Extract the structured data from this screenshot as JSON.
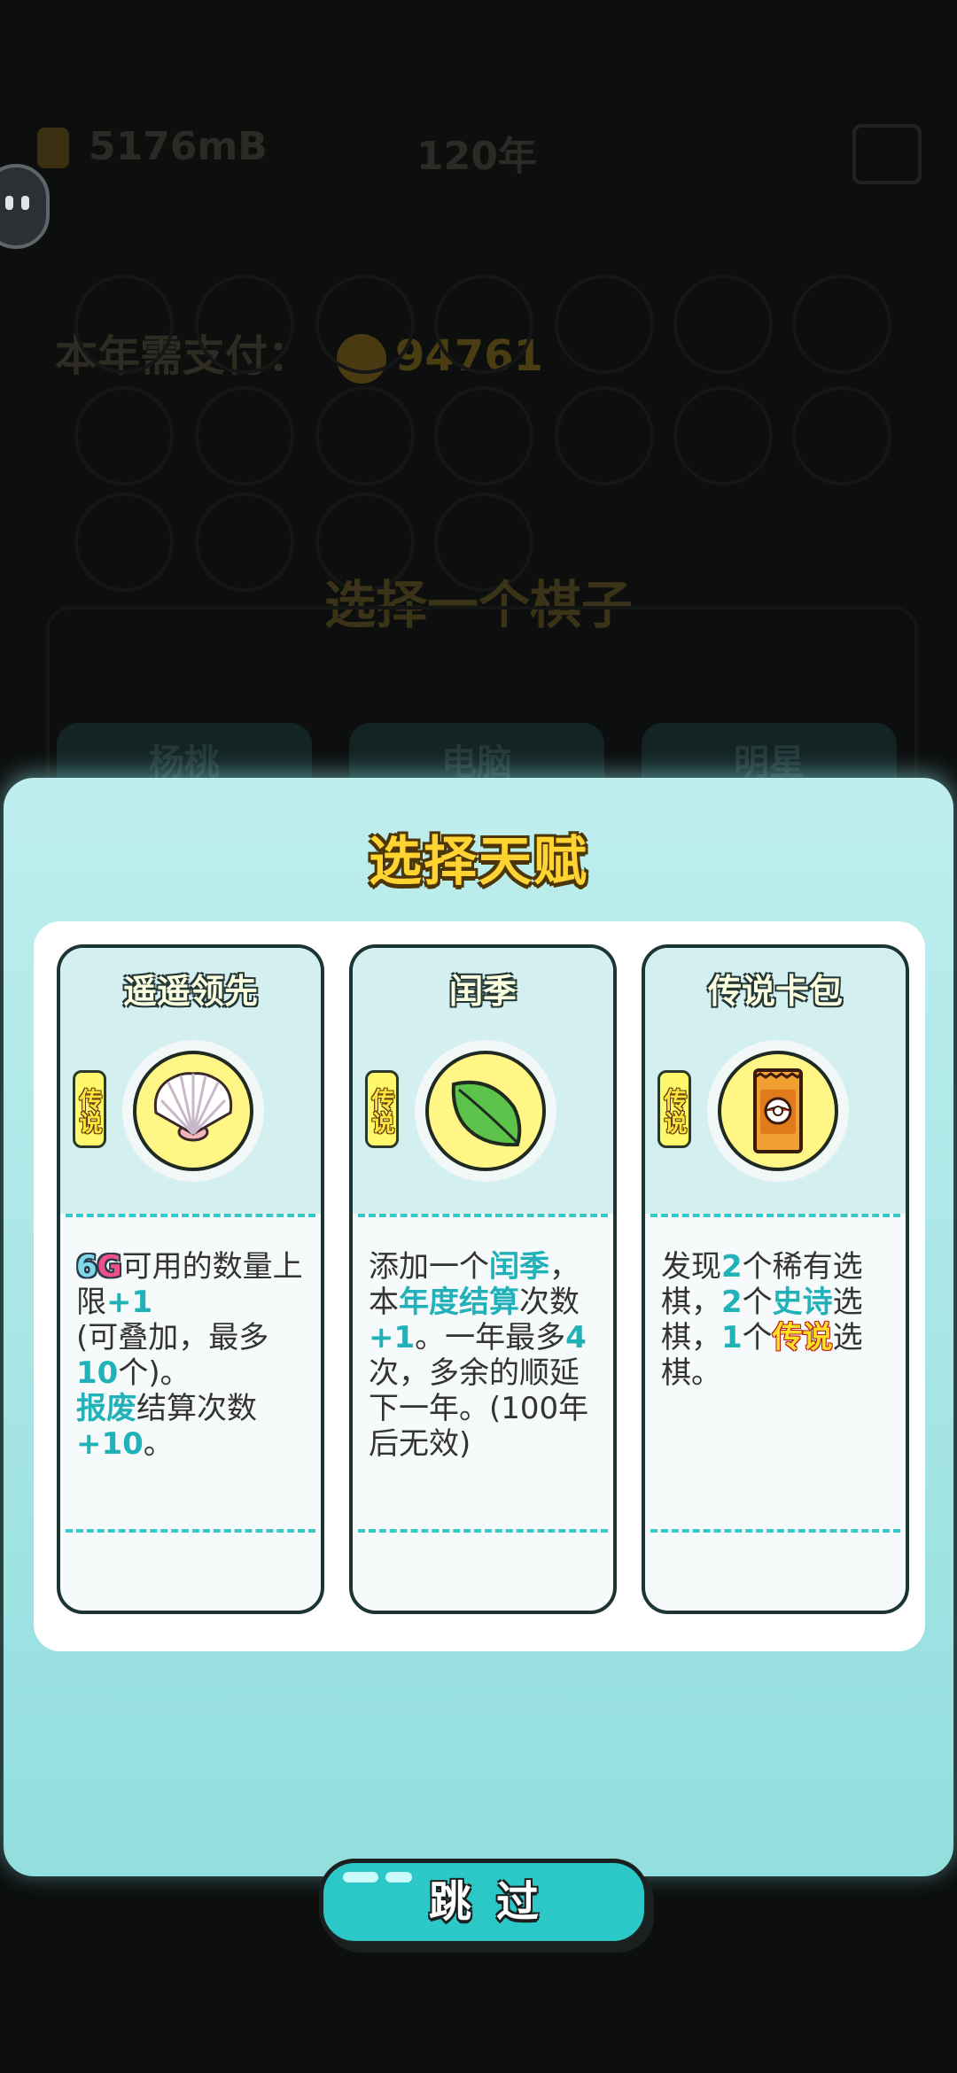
{
  "background": {
    "money": "5176mB",
    "year": "120年",
    "pay_label": "本年需支付：",
    "pay_amount": "94761",
    "select_piece_title": "选择一个棋子",
    "tabs": [
      "杨桃",
      "电脑",
      "明星"
    ]
  },
  "dialog": {
    "title": "选择天赋",
    "cards": [
      {
        "name": "遥遥领先",
        "rarity": "传说",
        "icon": "shell-icon",
        "desc": {
          "sixg_6": "6",
          "sixg_g": "G",
          "t1": "可用的数量上限",
          "h1": "+1",
          "t2": "(可叠加，最多",
          "h2": "10",
          "t3": "个)。",
          "h3": "报废",
          "t4": "结算次数",
          "h4": "+10",
          "t5": "。"
        }
      },
      {
        "name": "闰季",
        "rarity": "传说",
        "icon": "leaf-icon",
        "desc": {
          "t1": "添加一个",
          "h1": "闰季",
          "t2": "，本",
          "h2": "年度结算",
          "t3": "次数",
          "h3": "+1",
          "t4": "。一年最多",
          "h4": "4",
          "t5": "次，多余的顺延下一年。(100年后无效)"
        }
      },
      {
        "name": "传说卡包",
        "rarity": "传说",
        "icon": "card-pack-icon",
        "desc": {
          "t1": "发现",
          "h1": "2",
          "t2": "个稀有选棋，",
          "h2": "2",
          "t3": "个",
          "h3": "史诗",
          "t4": "选棋，",
          "h4": "1",
          "t5": "个",
          "h5": "传说",
          "t6": "选棋。"
        }
      }
    ],
    "skip_label": "跳过"
  }
}
